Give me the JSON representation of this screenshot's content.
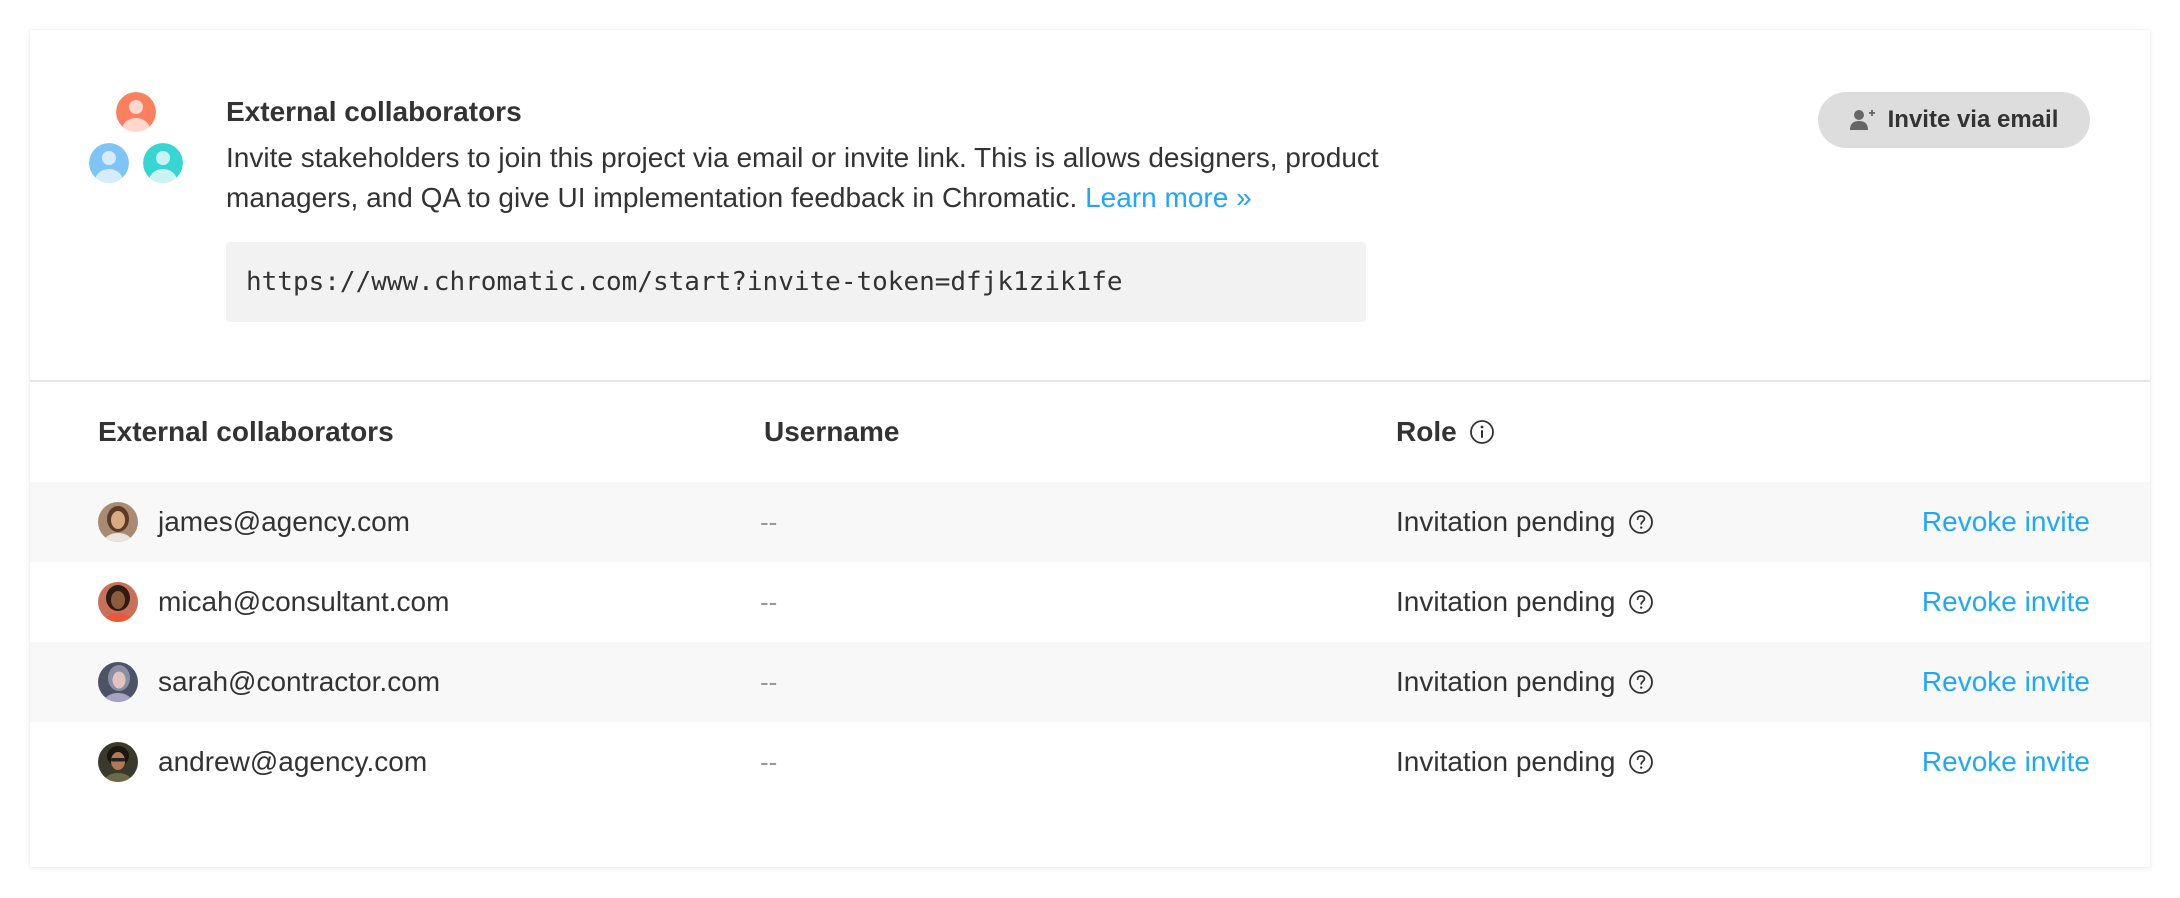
{
  "header": {
    "title": "External collaborators",
    "description": "Invite stakeholders to join this project via email or invite link. This is allows designers, product managers, and QA to give UI implementation feedback in Chromatic.",
    "learn_more": "Learn more »",
    "invite_link": "https://www.chromatic.com/start?invite-token=dfjk1zik1fe",
    "invite_button": "Invite via email",
    "icons": {
      "group": "group-users-icon",
      "button": "add-user-icon"
    }
  },
  "table": {
    "columns": {
      "collaborators": "External collaborators",
      "username": "Username",
      "role": "Role"
    },
    "rows": [
      {
        "email": "james@agency.com",
        "username": "--",
        "role": "Invitation pending",
        "action": "Revoke invite"
      },
      {
        "email": "micah@consultant.com",
        "username": "--",
        "role": "Invitation pending",
        "action": "Revoke invite"
      },
      {
        "email": "sarah@contractor.com",
        "username": "--",
        "role": "Invitation pending",
        "action": "Revoke invite"
      },
      {
        "email": "andrew@agency.com",
        "username": "--",
        "role": "Invitation pending",
        "action": "Revoke invite"
      }
    ]
  },
  "colors": {
    "link": "#1ea7fd",
    "avatar_top": "#fc7f5f",
    "avatar_left": "#7ec4f5",
    "avatar_right": "#37d5d3"
  }
}
